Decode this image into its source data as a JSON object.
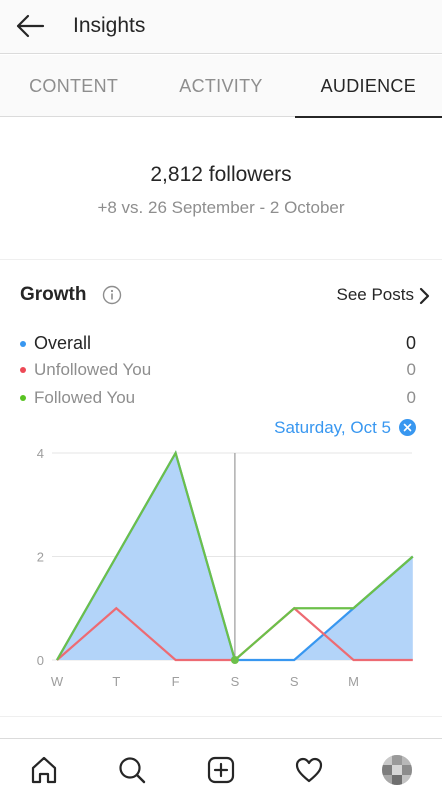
{
  "header": {
    "title": "Insights",
    "back_icon": "arrow-left-icon"
  },
  "tabs": [
    {
      "label": "CONTENT",
      "active": false
    },
    {
      "label": "ACTIVITY",
      "active": false
    },
    {
      "label": "AUDIENCE",
      "active": true
    }
  ],
  "summary": {
    "followers": "2,812 followers",
    "delta": "+8 vs. 26 September - 2 October"
  },
  "growth": {
    "title": "Growth",
    "see_posts": "See Posts",
    "legend": [
      {
        "label": "Overall",
        "value": "0",
        "color": "#3897f0"
      },
      {
        "label": "Unfollowed You",
        "value": "0",
        "color": "#ed4956"
      },
      {
        "label": "Followed You",
        "value": "0",
        "color": "#58c322"
      }
    ],
    "selected_date": "Saturday, Oct 5"
  },
  "chart_data": {
    "type": "line",
    "categories": [
      "W",
      "T",
      "F",
      "S",
      "S",
      "M",
      ""
    ],
    "y_ticks": [
      "0",
      "2",
      "4"
    ],
    "ylim": [
      0,
      4
    ],
    "series": [
      {
        "name": "Overall",
        "values": [
          0,
          2,
          4,
          0,
          0,
          1,
          2
        ],
        "color": "#3897f0",
        "fill": "#b3d4f9"
      },
      {
        "name": "Unfollowed You",
        "values": [
          0,
          1,
          0,
          0,
          1,
          0,
          0
        ],
        "color": "#ed6b73"
      },
      {
        "name": "Followed You",
        "values": [
          0,
          2,
          4,
          0,
          1,
          1,
          2
        ],
        "color": "#6cc04a"
      }
    ],
    "highlight_index": 3,
    "grid": true
  },
  "bottom_nav": {
    "items": [
      "home-icon",
      "search-icon",
      "new-post-icon",
      "activity-heart-icon",
      "profile-avatar"
    ]
  }
}
